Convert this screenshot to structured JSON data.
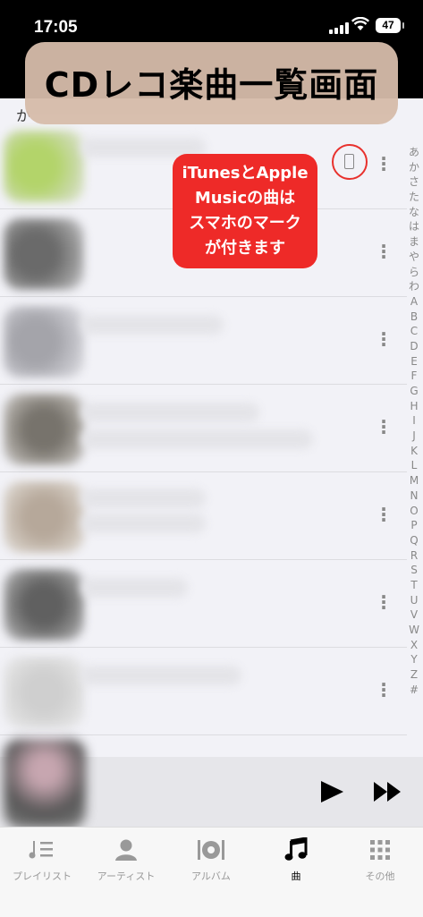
{
  "status": {
    "time": "17:05",
    "battery": "47"
  },
  "banner": "CDレコ楽曲一覧画面",
  "section_header": "か",
  "callout": {
    "lines": [
      "iTunesとApple",
      "Musicの曲は",
      "スマホのマーク",
      "が付きます"
    ]
  },
  "index_letters": [
    "あ",
    "か",
    "さ",
    "た",
    "な",
    "は",
    "ま",
    "や",
    "ら",
    "わ",
    "A",
    "B",
    "C",
    "D",
    "E",
    "F",
    "G",
    "H",
    "I",
    "J",
    "K",
    "L",
    "M",
    "N",
    "O",
    "P",
    "Q",
    "R",
    "S",
    "T",
    "U",
    "V",
    "W",
    "X",
    "Y",
    "Z",
    "#"
  ],
  "tabs": [
    {
      "label": "プレイリスト",
      "icon": "playlist-icon"
    },
    {
      "label": "アーティスト",
      "icon": "artist-icon"
    },
    {
      "label": "アルバム",
      "icon": "album-icon"
    },
    {
      "label": "曲",
      "icon": "music-note-icon",
      "active": true
    },
    {
      "label": "その他",
      "icon": "grid-icon"
    }
  ],
  "colors": {
    "callout": "#ee2a28",
    "banner": "#d6bcaa",
    "active_tab": "#000000",
    "inactive_tab": "#999999"
  }
}
